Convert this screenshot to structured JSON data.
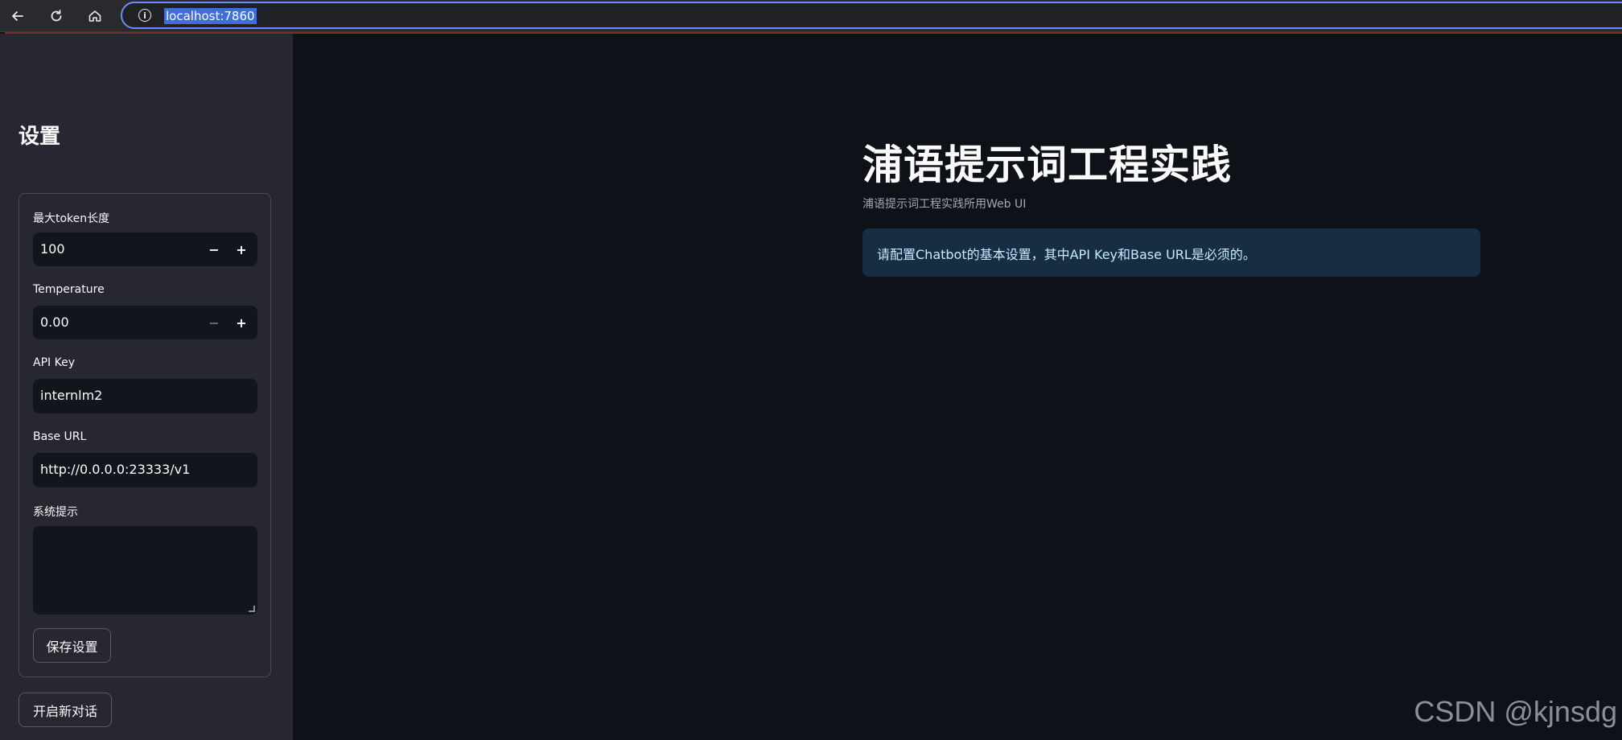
{
  "browser": {
    "url": "localhost:7860",
    "info_icon": "info-icon"
  },
  "sidebar": {
    "title": "设置",
    "max_tokens": {
      "label": "最大token长度",
      "value": "100",
      "minus": "−",
      "plus": "+"
    },
    "temperature": {
      "label": "Temperature",
      "value": "0.00",
      "minus": "−",
      "plus": "+"
    },
    "api_key": {
      "label": "API Key",
      "value": "internlm2"
    },
    "base_url": {
      "label": "Base URL",
      "value": "http://0.0.0.0:23333/v1"
    },
    "system_prompt": {
      "label": "系统提示",
      "value": ""
    },
    "save_label": "保存设置",
    "new_chat_label": "开启新对话"
  },
  "main": {
    "title": "浦语提示词工程实践",
    "caption": "浦语提示词工程实践所用Web UI",
    "info_message": "请配置Chatbot的基本设置，其中API Key和Base URL是必须的。"
  },
  "watermark": "CSDN @kjnsdg",
  "colors": {
    "background": "#0e1117",
    "sidebar": "#262730",
    "info_alert_bg": "#172d43",
    "info_alert_text": "#c7ebff"
  }
}
